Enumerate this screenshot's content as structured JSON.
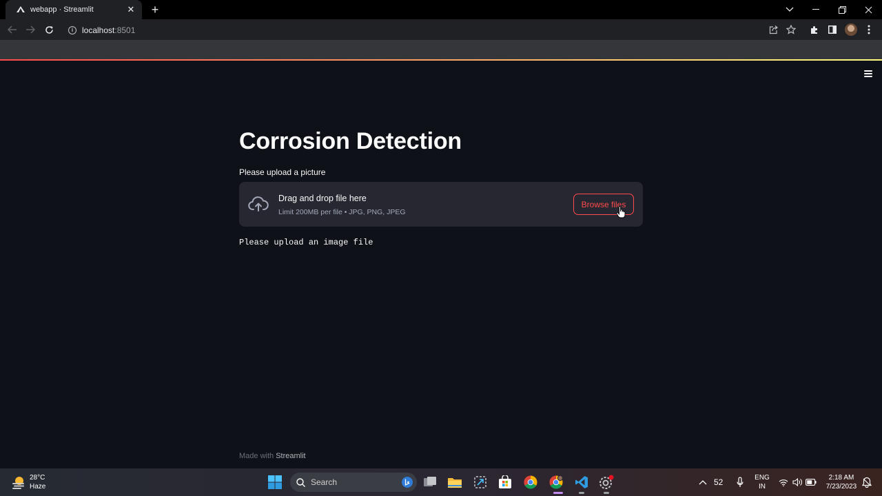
{
  "browser": {
    "tab_title": "webapp · Streamlit",
    "url_host": "localhost",
    "url_port": ":8501",
    "icons": [
      "streamlit-favicon",
      "close-icon",
      "plus-icon",
      "chevron-down-icon",
      "minimize-icon",
      "restore-icon",
      "close-window-icon",
      "back-icon",
      "forward-icon",
      "reload-icon",
      "info-icon",
      "share-icon",
      "star-icon",
      "extensions-icon",
      "sidepanel-icon",
      "profile-avatar",
      "kebab-icon"
    ]
  },
  "app": {
    "title": "Corrosion Detection",
    "uploader_label": "Please upload a picture",
    "dropzone_title": "Drag and drop file here",
    "dropzone_limit": "Limit 200MB per file • JPG, PNG, JPEG",
    "browse_label": "Browse files",
    "message": "Please upload an image file",
    "footer_prefix": "Made with ",
    "footer_brand": "Streamlit",
    "colors": {
      "background": "#0e1117",
      "primary": "#ff4b4b",
      "dropzone": "#262730"
    }
  },
  "taskbar": {
    "weather_temp": "28°C",
    "weather_desc": "Haze",
    "search_label": "Search",
    "tray_number": "52",
    "lang_1": "ENG",
    "lang_2": "IN",
    "time": "2:18 AM",
    "date": "7/23/2023"
  }
}
